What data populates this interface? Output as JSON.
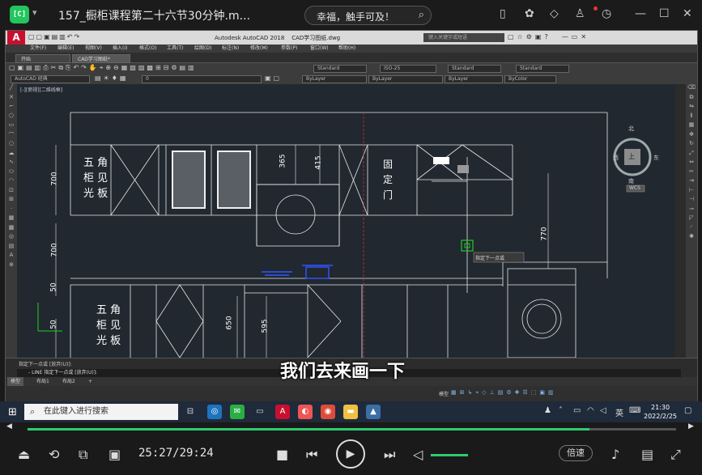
{
  "player": {
    "title": "157_橱柜课程第二十六节30分钟.m...",
    "search": "幸福，触手可及！",
    "time": "25:27/29:24",
    "progress": 0.866,
    "speed": "倍速",
    "subtitle": "我们去来画一下"
  },
  "acad": {
    "app_title": "Autodesk AutoCAD 2018",
    "file": "CAD学习图纸.dwg",
    "search_placeholder": "键入关键字或短语",
    "menu": [
      "文件(F)",
      "编辑(E)",
      "视图(V)",
      "插入(I)",
      "格式(O)",
      "工具(T)",
      "绘图(D)",
      "标注(N)",
      "修改(M)",
      "参数(P)",
      "窗口(W)",
      "帮助(H)"
    ],
    "tabs": [
      "开始",
      "CAD学习图纸*"
    ],
    "workspace": "AutoCAD 经典",
    "layer": "0",
    "text_style": "Standard",
    "dim_style": "ISO-25",
    "table_style": "Standard",
    "ml_style": "Standard",
    "bylayer1": "ByLayer",
    "bylayer2": "ByLayer",
    "bylayer3": "ByLayer",
    "bycolor": "ByColor",
    "viewport_label": "[-][俯视][二维线框]",
    "viewcube": {
      "north": "北",
      "south": "南",
      "east": "东",
      "west": "西",
      "top": "上",
      "wcs": "WCS"
    },
    "tooltip": "指定下一点或",
    "cmd_history": "指定下一点或 [放弃(U)]:",
    "cmd_prompt": "- LINE 指定下一点或 [放弃(U)]:",
    "layout_tabs": [
      "模型",
      "布局1",
      "布局2",
      "+"
    ],
    "status_label": "模型",
    "drawing": {
      "upper_left_label": [
        "五",
        "角",
        "柜",
        "见",
        "光",
        "板"
      ],
      "lower_left_label": [
        "五",
        "角",
        "柜",
        "见",
        "光",
        "板"
      ],
      "fixed_door": [
        "固",
        "定",
        "门"
      ],
      "dims": {
        "d700a": "700",
        "d700b": "700",
        "d50a": "50",
        "d50b": "50",
        "d365": "365",
        "d415": "415",
        "d770": "770",
        "d650": "650",
        "d595": "595"
      }
    }
  },
  "taskbar": {
    "search": "在此键入进行搜索",
    "tray_lang": "英",
    "time": "21:30",
    "date": "2022/2/25"
  }
}
